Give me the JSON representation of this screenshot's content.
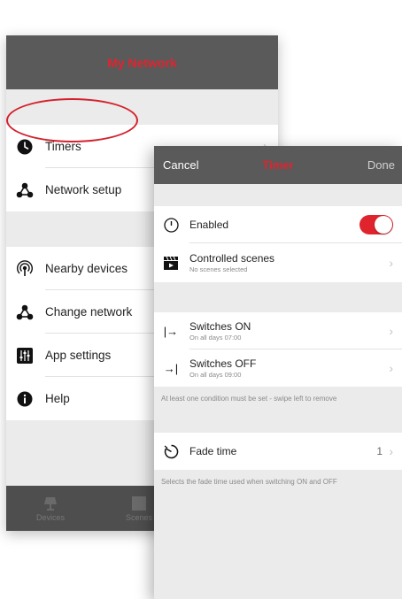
{
  "network_screen": {
    "title": "My Network",
    "groups": [
      [
        {
          "label": "Timers",
          "icon": "clock-icon",
          "has_chevron": true
        },
        {
          "label": "Network setup",
          "icon": "network-icon"
        }
      ],
      [
        {
          "label": "Nearby devices",
          "icon": "broadcast-icon"
        },
        {
          "label": "Change network",
          "icon": "network-icon"
        },
        {
          "label": "App settings",
          "icon": "sliders-icon"
        },
        {
          "label": "Help",
          "icon": "info-icon"
        }
      ]
    ],
    "tabs": [
      {
        "label": "Devices",
        "icon": "lamp-icon"
      },
      {
        "label": "Scenes",
        "icon": "scene-icon"
      }
    ]
  },
  "timer_screen": {
    "cancel_label": "Cancel",
    "title": "Timer",
    "done_label": "Done",
    "enabled_label": "Enabled",
    "enabled": true,
    "controlled_scenes": {
      "title": "Controlled scenes",
      "subtitle": "No scenes selected"
    },
    "switches_on": {
      "icon_text": "|→",
      "title": "Switches ON",
      "subtitle": "On all days  07:00"
    },
    "switches_off": {
      "icon_text": "→|",
      "title": "Switches OFF",
      "subtitle": "On all days  09:00"
    },
    "conditions_note": "At least one condition must be set - swipe left to remove",
    "fade_time": {
      "title": "Fade time",
      "value": "1"
    },
    "fade_note": "Selects the fade time used when switching ON and OFF"
  },
  "colors": {
    "accent": "#e0242e",
    "navbar": "#5a5a5a",
    "background": "#ebebeb"
  }
}
